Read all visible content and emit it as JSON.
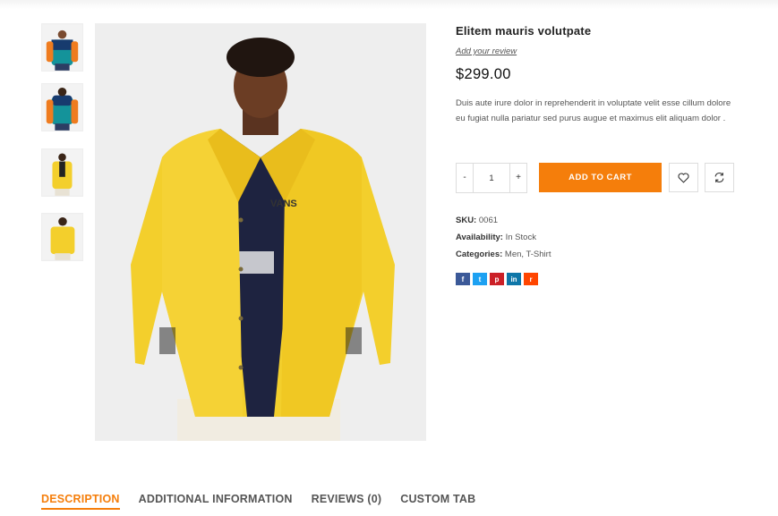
{
  "product": {
    "title": "Elitem mauris volutpate",
    "review_link": "Add your review",
    "price": "$299.00",
    "description": "Duis aute irure dolor in reprehenderit in voluptate velit esse cillum dolore eu fugiat nulla pariatur sed purus augue et maximus elit aliquam dolor ."
  },
  "quantity": {
    "minus": "-",
    "value": "1",
    "plus": "+"
  },
  "buttons": {
    "add_to_cart": "ADD TO CART",
    "wishlist_icon": "heart-icon",
    "compare_icon": "refresh-icon"
  },
  "meta": {
    "sku_label": "SKU:",
    "sku_value": "0061",
    "availability_label": "Availability:",
    "availability_value": "In Stock",
    "categories_label": "Categories:",
    "categories_value": "Men, T-Shirt"
  },
  "social": [
    {
      "name": "facebook",
      "glyph": "f",
      "color": "#3b5998"
    },
    {
      "name": "twitter",
      "glyph": "t",
      "color": "#1da1f2"
    },
    {
      "name": "pinterest",
      "glyph": "p",
      "color": "#cb2027"
    },
    {
      "name": "linkedin",
      "glyph": "in",
      "color": "#0e76a8"
    },
    {
      "name": "reddit",
      "glyph": "r",
      "color": "#ff4500"
    }
  ],
  "tabs": [
    {
      "label": "DESCRIPTION",
      "active": true
    },
    {
      "label": "ADDITIONAL INFORMATION",
      "active": false
    },
    {
      "label": "REVIEWS (0)",
      "active": false
    },
    {
      "label": "CUSTOM TAB",
      "active": false
    }
  ],
  "colors": {
    "accent": "#f57e0b",
    "jacket_yellow": "#f3cf2c"
  }
}
